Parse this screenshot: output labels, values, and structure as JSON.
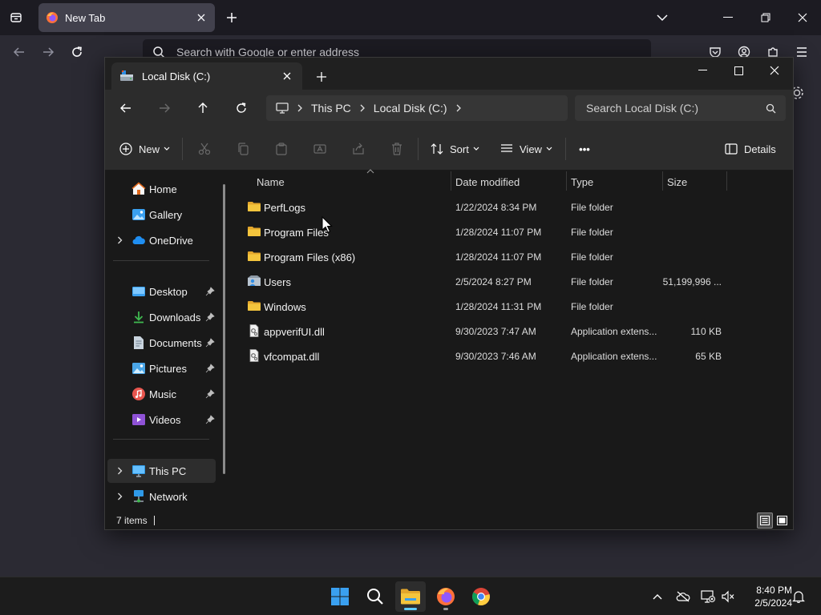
{
  "firefox": {
    "tab_title": "New Tab",
    "url_placeholder": "Search with Google or enter address"
  },
  "explorer": {
    "tab_title": "Local Disk (C:)",
    "breadcrumb": [
      "This PC",
      "Local Disk (C:)"
    ],
    "search_placeholder": "Search Local Disk (C:)",
    "toolbar": {
      "new_label": "New",
      "sort_label": "Sort",
      "view_label": "View",
      "more_label": "•••",
      "details_label": "Details"
    },
    "nav": {
      "home": "Home",
      "gallery": "Gallery",
      "onedrive": "OneDrive",
      "desktop": "Desktop",
      "downloads": "Downloads",
      "documents": "Documents",
      "pictures": "Pictures",
      "music": "Music",
      "videos": "Videos",
      "this_pc": "This PC",
      "network": "Network"
    },
    "columns": {
      "name": "Name",
      "date": "Date modified",
      "type": "Type",
      "size": "Size"
    },
    "files": [
      {
        "name": "PerfLogs",
        "date": "1/22/2024 8:34 PM",
        "type": "File folder",
        "size": "",
        "icon": "folder-icon"
      },
      {
        "name": "Program Files",
        "date": "1/28/2024 11:07 PM",
        "type": "File folder",
        "size": "",
        "icon": "folder-icon"
      },
      {
        "name": "Program Files (x86)",
        "date": "1/28/2024 11:07 PM",
        "type": "File folder",
        "size": "",
        "icon": "folder-icon"
      },
      {
        "name": "Users",
        "date": "2/5/2024 8:27 PM",
        "type": "File folder",
        "size": "51,199,996 ...",
        "icon": "users-folder-icon"
      },
      {
        "name": "Windows",
        "date": "1/28/2024 11:31 PM",
        "type": "File folder",
        "size": "",
        "icon": "folder-icon"
      },
      {
        "name": "appverifUI.dll",
        "date": "9/30/2023 7:47 AM",
        "type": "Application extens...",
        "size": "110 KB",
        "icon": "dll-file-icon"
      },
      {
        "name": "vfcompat.dll",
        "date": "9/30/2023 7:46 AM",
        "type": "Application extens...",
        "size": "65 KB",
        "icon": "dll-file-icon"
      }
    ],
    "status": {
      "item_count": "7 items"
    }
  },
  "taskbar": {
    "time": "8:40 PM",
    "date": "2/5/2024"
  },
  "colors": {
    "folder_yellow": "#f4c53d",
    "accent_blue": "#60cdff"
  }
}
